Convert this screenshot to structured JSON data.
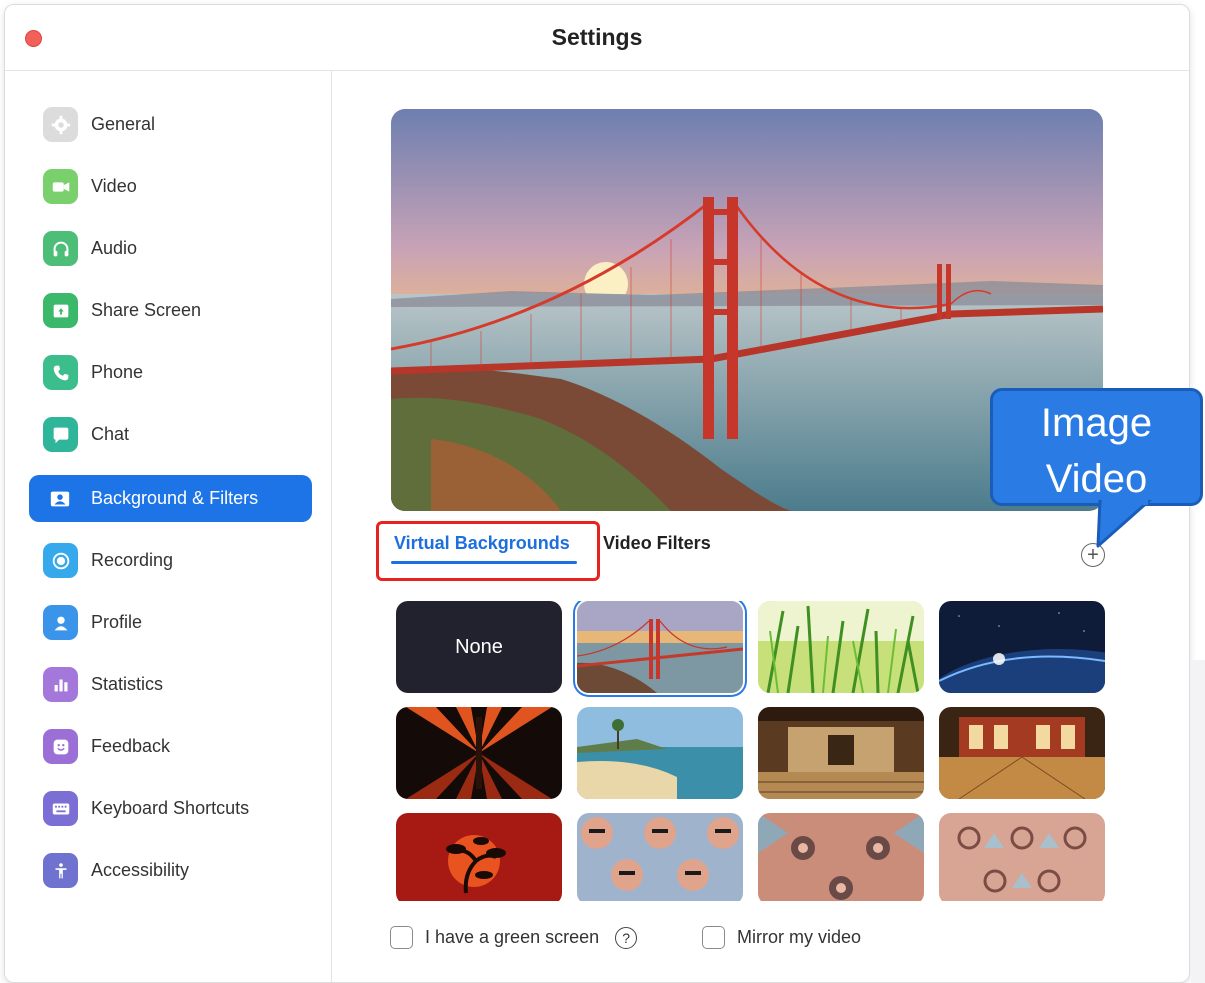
{
  "window": {
    "title": "Settings"
  },
  "sidebar": {
    "items": [
      {
        "label": "General",
        "icon": "gear-icon",
        "color": "#d7d7d7"
      },
      {
        "label": "Video",
        "icon": "video-camera-icon",
        "color": "#76d16c"
      },
      {
        "label": "Audio",
        "icon": "headphones-icon",
        "color": "#4cbe77"
      },
      {
        "label": "Share Screen",
        "icon": "share-screen-icon",
        "color": "#3bb86a"
      },
      {
        "label": "Phone",
        "icon": "phone-icon",
        "color": "#3bbd8c"
      },
      {
        "label": "Chat",
        "icon": "chat-bubble-icon",
        "color": "#2fb59a"
      },
      {
        "label": "Background & Filters",
        "icon": "person-card-icon",
        "color": "#ffffff"
      },
      {
        "label": "Recording",
        "icon": "record-icon",
        "color": "#2ba8ea"
      },
      {
        "label": "Profile",
        "icon": "person-icon",
        "color": "#3a95ea"
      },
      {
        "label": "Statistics",
        "icon": "bar-chart-icon",
        "color": "#a477db"
      },
      {
        "label": "Feedback",
        "icon": "smiley-icon",
        "color": "#9c6fd6"
      },
      {
        "label": "Keyboard Shortcuts",
        "icon": "keyboard-icon",
        "color": "#7b6fd6"
      },
      {
        "label": "Accessibility",
        "icon": "accessibility-icon",
        "color": "#6f72cf"
      }
    ],
    "active_index": 6,
    "accent": "#1d74e7"
  },
  "tabs": {
    "virtual": "Virtual Backgrounds",
    "filters": "Video Filters",
    "active": "virtual"
  },
  "backgrounds": {
    "none_label": "None",
    "selected": "golden-gate-bridge",
    "items": [
      "none",
      "golden-gate-bridge",
      "grass",
      "earth-from-space",
      "red-abstract",
      "beach",
      "dojo-interior",
      "dojo-hall",
      "red-bonsai",
      "kaleidoscope-faces-1",
      "kaleidoscope-faces-2",
      "kaleidoscope-faces-3"
    ]
  },
  "options": {
    "green_screen": "I have a green screen",
    "mirror": "Mirror my video"
  },
  "callout": {
    "line1": "Image",
    "line2": "Video"
  }
}
